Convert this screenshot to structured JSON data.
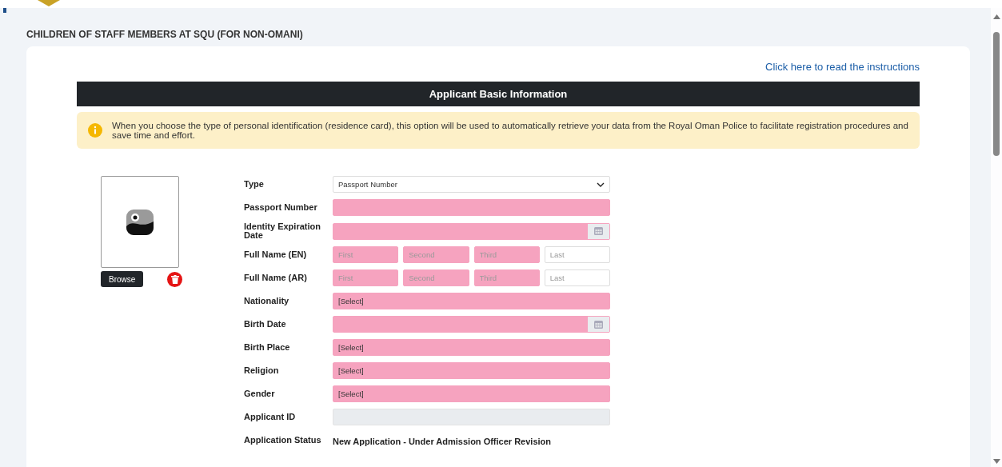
{
  "page_title": "CHILDREN OF STAFF MEMBERS AT SQU (FOR NON-OMANI)",
  "instructions_link": "Click here to read the instructions",
  "section_title": "Applicant Basic Information",
  "notice": "When you choose the type of personal identification (residence card), this option will be used to automatically retrieve your data from the Royal Oman Police to facilitate registration procedures and save time and effort.",
  "photo": {
    "browse_label": "Browse"
  },
  "fields": [
    {
      "kind": "select",
      "label": "Type",
      "value": "Passport Number",
      "required": false
    },
    {
      "kind": "text",
      "label": "Passport Number",
      "required": true
    },
    {
      "kind": "date",
      "label": "Identity Expiration Date",
      "required": true
    },
    {
      "kind": "name",
      "label": "Full Name (EN)",
      "parts": [
        {
          "placeholder": "First",
          "required": true
        },
        {
          "placeholder": "Second",
          "required": true
        },
        {
          "placeholder": "Third",
          "required": true
        },
        {
          "placeholder": "Last",
          "required": false
        }
      ]
    },
    {
      "kind": "name",
      "label": "Full Name (AR)",
      "parts": [
        {
          "placeholder": "First",
          "required": true
        },
        {
          "placeholder": "Second",
          "required": true
        },
        {
          "placeholder": "Third",
          "required": true
        },
        {
          "placeholder": "Last",
          "required": false
        }
      ]
    },
    {
      "kind": "lookup",
      "label": "Nationality",
      "value": "[Select]",
      "required": true
    },
    {
      "kind": "date",
      "label": "Birth Date",
      "required": true
    },
    {
      "kind": "lookup",
      "label": "Birth Place",
      "value": "[Select]",
      "required": true
    },
    {
      "kind": "lookup",
      "label": "Religion",
      "value": "[Select]",
      "required": true
    },
    {
      "kind": "lookup",
      "label": "Gender",
      "value": "[Select]",
      "required": true
    },
    {
      "kind": "readonly",
      "label": "Applicant ID",
      "disabled": true
    },
    {
      "kind": "status",
      "label": "Application Status",
      "value": "New Application - Under Admission Officer Revision"
    }
  ]
}
